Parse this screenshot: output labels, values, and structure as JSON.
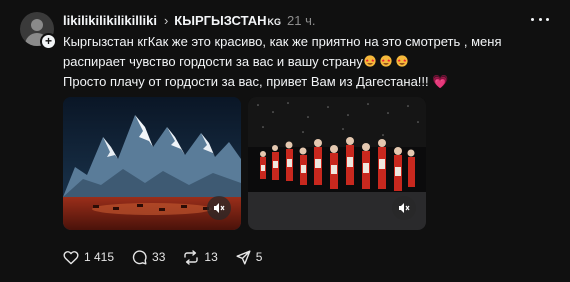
{
  "post": {
    "username": "likilikilikilikilliki",
    "community": "КЫРГЫЗСТАН",
    "community_suffix": "KG",
    "time": "21 ч.",
    "line1": "Кыргызстан кгКак же это красиво, как же приятно на это смотреть , меня",
    "line2": "распирает чувство гордости за вас и вашу страну",
    "line3": "Просто плачу от гордости за вас, привет Вам из Дагестана!!!",
    "heart": "💗"
  },
  "actions": {
    "likes": "1 415",
    "comments": "33",
    "reposts": "13",
    "shares": "5"
  },
  "colors": {
    "background": "#101010",
    "text": "#f3f5f7",
    "muted": "#8e8e8e",
    "heart": "#f0508a"
  },
  "icons": [
    "more-icon",
    "chevron-right-icon",
    "mute-icon",
    "heart-icon",
    "comment-icon",
    "repost-icon",
    "share-icon",
    "star-struck-emoji-icon"
  ]
}
